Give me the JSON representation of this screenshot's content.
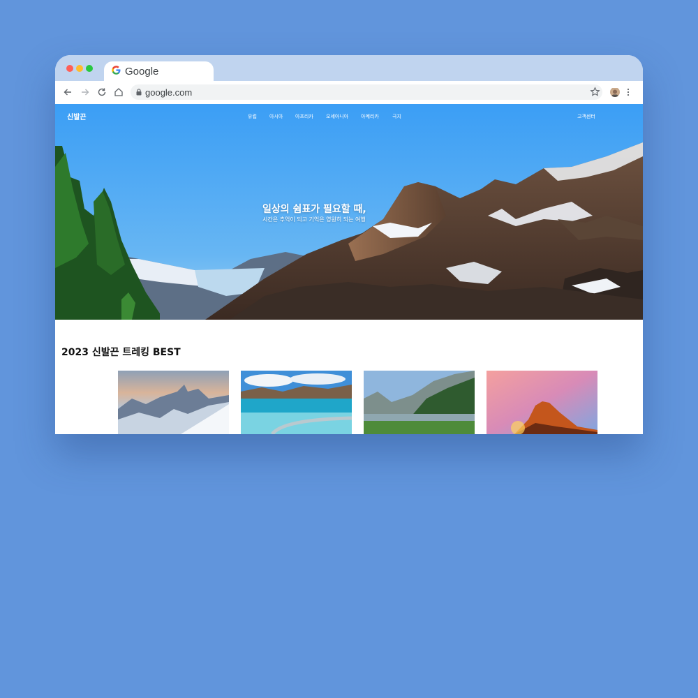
{
  "browser": {
    "tab_title": "Google",
    "url": "google.com"
  },
  "site": {
    "logo": "신발끈",
    "nav": [
      "유럽",
      "아시아",
      "아프리카",
      "오세아니아",
      "아메리카",
      "극지"
    ],
    "support": "고객센터"
  },
  "hero": {
    "title": "일상의 쉼표가 필요할 때,",
    "subtitle": "시간은 추억이 되고 기억은 영원히 되는 여행"
  },
  "best": {
    "title": "2023 신발끈 트레킹 BEST"
  },
  "colors": {
    "page_background": "#6195dc",
    "browser_chrome": "#c0d4ef",
    "hero_sky": "#4aa3f0"
  }
}
